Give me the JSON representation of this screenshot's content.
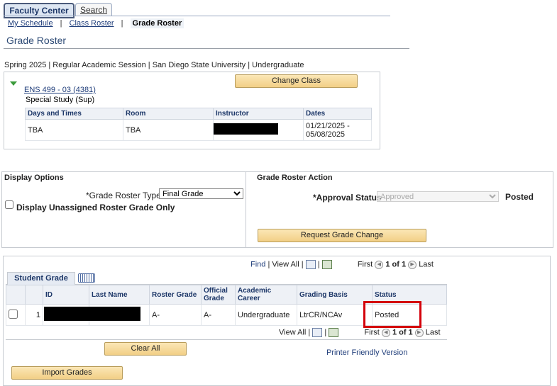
{
  "tabs": {
    "active": "Faculty Center",
    "search": "Search"
  },
  "breadcrumb": {
    "my_schedule": "My Schedule",
    "class_roster": "Class Roster",
    "current": "Grade Roster",
    "separator": "|"
  },
  "page_title": "Grade Roster",
  "term_line": "Spring 2025 | Regular Academic Session | San Diego State University | Undergraduate",
  "class_info": {
    "course_link": "ENS 499 - 03 (4381)",
    "course_title": "Special Study (Sup)",
    "change_class_label": "Change Class",
    "table": {
      "headers": [
        "Days and Times",
        "Room",
        "Instructor",
        "Dates"
      ],
      "row": {
        "days": "TBA",
        "room": "TBA",
        "dates_line1": "01/21/2025 -",
        "dates_line2": "05/08/2025"
      }
    }
  },
  "display_options": {
    "title": "Display Options",
    "roster_type_label": "*Grade Roster Type",
    "roster_type_value": "Final Grade",
    "unassigned_label": "Display Unassigned Roster Grade Only"
  },
  "roster_action": {
    "title": "Grade Roster Action",
    "approval_label": "*Approval Status",
    "approval_value": "Approved",
    "status_text": "Posted",
    "request_change_label": "Request Grade Change"
  },
  "grid": {
    "find": "Find",
    "view_all": "View All",
    "first": "First",
    "range": "1 of 1",
    "last": "Last",
    "tab_label": "Student Grade",
    "headers": [
      "ID",
      "Last Name",
      "Roster Grade",
      "Official Grade",
      "Academic Career",
      "Grading Basis",
      "Status"
    ],
    "rows": [
      {
        "num": "1",
        "roster_grade": "A-",
        "official_grade": "A-",
        "career": "Undergraduate",
        "basis": "LtrCR/NCAv",
        "status": "Posted"
      }
    ]
  },
  "clear_all_label": "Clear All",
  "printer_link": "Printer Friendly Version",
  "import_grades_label": "Import Grades",
  "colors": {
    "highlight": "#d4000a",
    "button": "#f2cf86",
    "link": "#1f3d7a"
  }
}
